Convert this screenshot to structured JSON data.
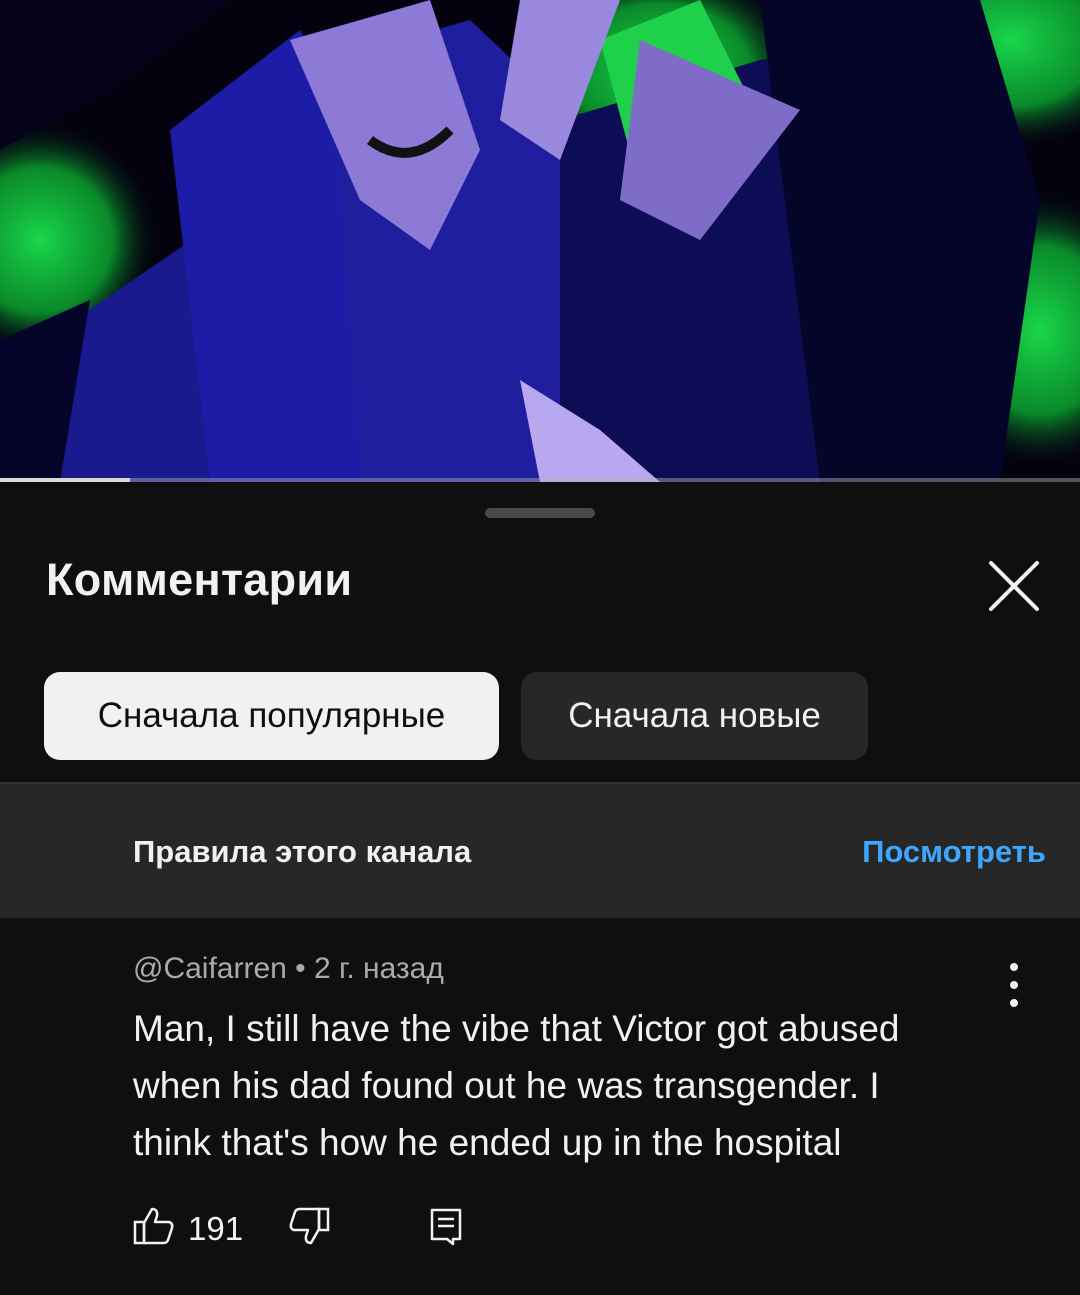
{
  "video": {
    "progress_fraction": 0.12
  },
  "comments_sheet": {
    "title": "Комментарии",
    "close_icon": "close-icon",
    "sort_chips": [
      {
        "label": "Сначала популярные",
        "selected": true
      },
      {
        "label": "Сначала новые",
        "selected": false
      }
    ],
    "rules": {
      "text": "Правила этого канала",
      "link_label": "Посмотреть",
      "link_color": "#3ea6ff"
    },
    "comment": {
      "author": "@Caifarren",
      "separator": " • ",
      "time": "2 г. назад",
      "text": "Man, I still have the vibe that Victor got abused when his dad found out he was transgender. I think that's how he ended up in the hospital",
      "like_count": "191",
      "icons": [
        "like-icon",
        "dislike-icon",
        "reply-icon",
        "more-vert-icon"
      ]
    }
  },
  "colors": {
    "background": "#0f0f0f",
    "chip_active_bg": "#f1f1f1",
    "chip_inactive_bg": "#272727",
    "rules_bg": "#272727",
    "secondary_text": "#aaaaaa"
  }
}
